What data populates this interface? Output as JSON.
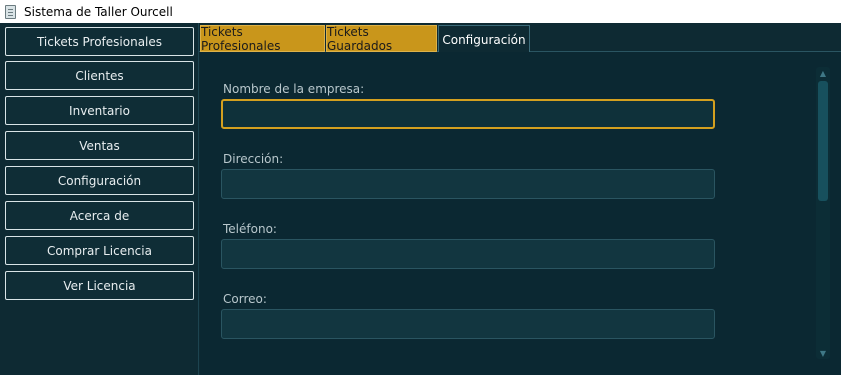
{
  "window": {
    "title": "Sistema de Taller Ourcell",
    "icon": "app-document-icon"
  },
  "sidebar": {
    "items": [
      {
        "label": "Tickets Profesionales"
      },
      {
        "label": "Clientes"
      },
      {
        "label": "Inventario"
      },
      {
        "label": "Ventas"
      },
      {
        "label": "Configuración"
      },
      {
        "label": "Acerca de"
      },
      {
        "label": "Comprar Licencia"
      },
      {
        "label": "Ver Licencia"
      }
    ]
  },
  "tabs": [
    {
      "label": "Tickets Profesionales",
      "active": false
    },
    {
      "label": "Tickets Guardados",
      "active": false
    },
    {
      "label": "Configuración",
      "active": true
    }
  ],
  "form": {
    "fields": [
      {
        "label": "Nombre de la empresa:",
        "value": "",
        "focused": true
      },
      {
        "label": "Dirección:",
        "value": "",
        "focused": false
      },
      {
        "label": "Teléfono:",
        "value": "",
        "focused": false
      },
      {
        "label": "Correo:",
        "value": "",
        "focused": false
      }
    ]
  },
  "colors": {
    "background": "#0e2a33",
    "accent_gold": "#c9961b",
    "field_background": "#123640",
    "focus_border": "#d4a01f"
  }
}
